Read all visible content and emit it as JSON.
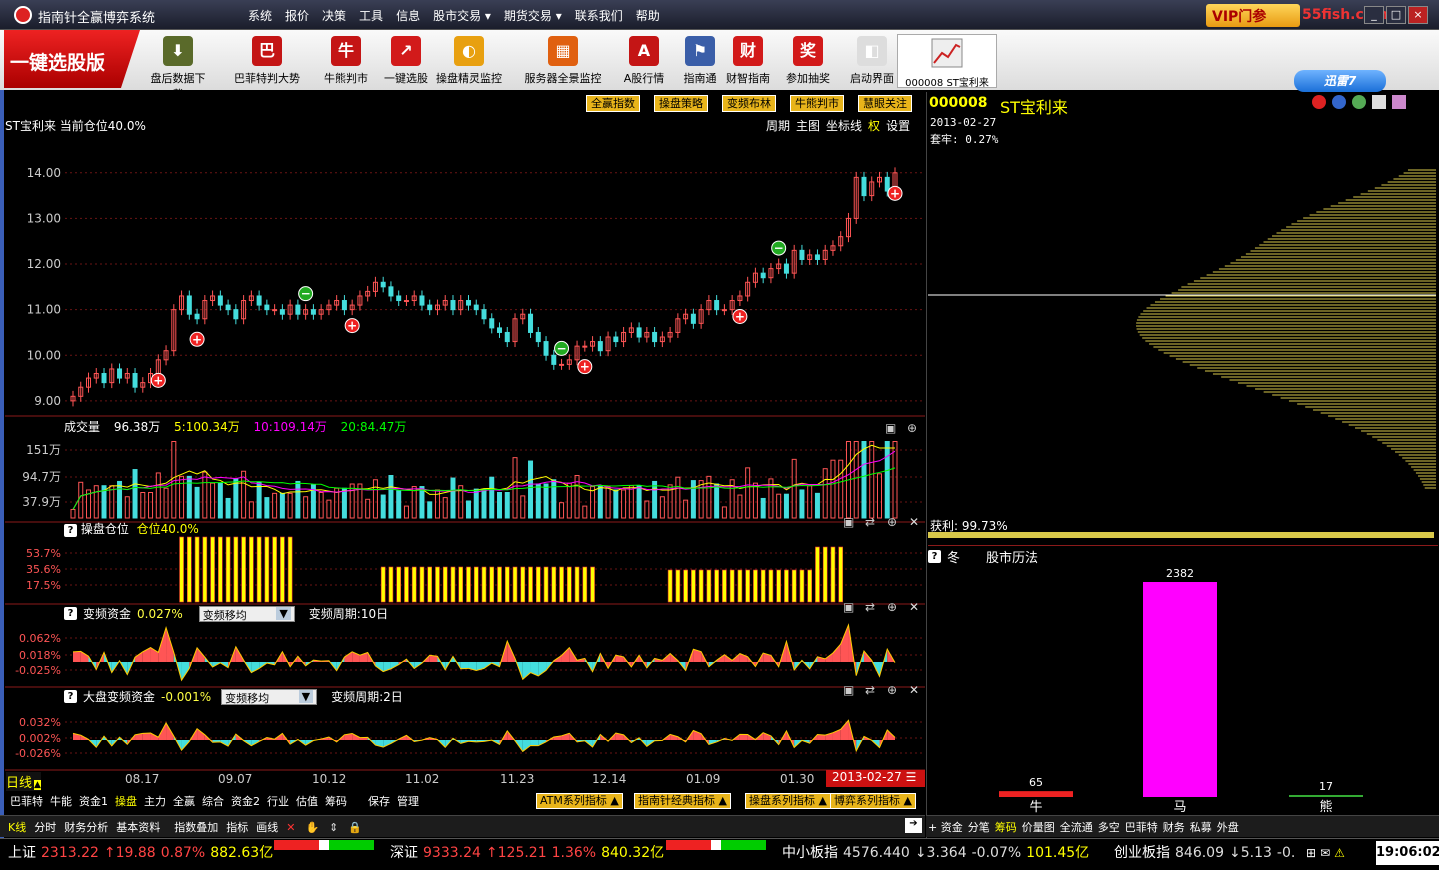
{
  "app": {
    "title": "指南针全赢博弈系统",
    "vip": "VIP门参",
    "site": "55fish.com"
  },
  "menu": [
    "系统",
    "报价",
    "决策",
    "工具",
    "信息",
    "股市交易",
    "期货交易",
    "联系我们",
    "帮助"
  ],
  "brand": "一键选股版",
  "toolbar": [
    {
      "label": "盘后数据下载",
      "icon": "download-icon",
      "color": "#5a6a2a"
    },
    {
      "label": "巴菲特判大势",
      "icon": "buffett-icon",
      "color": "#c41515"
    },
    {
      "label": "牛熊判市",
      "icon": "bull-bear-icon",
      "color": "#c41515"
    },
    {
      "label": "一键选股",
      "icon": "one-click-icon",
      "color": "#d21a1a"
    },
    {
      "label": "操盘精灵监控",
      "icon": "monitor-icon",
      "color": "#e8a010"
    },
    {
      "label": "服务器全景监控",
      "icon": "server-icon",
      "color": "#e06010"
    },
    {
      "label": "A股行情",
      "icon": "a-share-icon",
      "color": "#c41515"
    },
    {
      "label": "指南通",
      "icon": "guide-icon",
      "color": "#3a5ea8"
    },
    {
      "label": "财智指南",
      "icon": "finance-icon",
      "color": "#d21a1a"
    },
    {
      "label": "参加抽奖",
      "icon": "lottery-icon",
      "color": "#d21a1a"
    },
    {
      "label": "启动界面",
      "icon": "startup-icon",
      "color": "#dddddd"
    }
  ],
  "thumb": {
    "label": "000008 ST宝利来"
  },
  "xunlei": "迅雷7",
  "chart_buttons": [
    "全赢指数",
    "操盘策略",
    "变频布林",
    "牛熊判市",
    "慧眼关注"
  ],
  "main": {
    "header": "ST宝利来 当前仓位40.0%",
    "menu": [
      "周期",
      "主图",
      "坐标线",
      "权",
      "设置"
    ]
  },
  "volume": {
    "label": "成交量",
    "v": "96.38万",
    "ma5": "5:100.34万",
    "ma10": "10:109.14万",
    "ma20": "20:84.47万"
  },
  "pos": {
    "label": "操盘仓位",
    "value": "仓位40.0%",
    "ticks": [
      "53.7%",
      "35.6%",
      "17.5%"
    ]
  },
  "bp": {
    "label": "变频资金",
    "value": "0.027%",
    "select": "变频移均",
    "period": "变频周期:10日",
    "ticks": [
      "0.062%",
      "0.018%",
      "-0.025%"
    ]
  },
  "dp": {
    "label": "大盘变频资金",
    "value": "-0.001%",
    "select": "变频移均",
    "period": "变频周期:2日",
    "ticks": [
      "0.032%",
      "0.002%",
      "-0.026%"
    ]
  },
  "xaxis": {
    "period": "日线",
    "dates": [
      "08.17",
      "09.07",
      "10.12",
      "11.02",
      "11.23",
      "12.14",
      "01.09",
      "01.30"
    ],
    "current": "2013-02-27"
  },
  "bottabs": [
    "巴菲特",
    "牛能",
    "资金1",
    "操盘",
    "主力",
    "全赢",
    "综合",
    "资金2",
    "行业",
    "估值",
    "筹码",
    "保存",
    "管理"
  ],
  "indicator_buttons": [
    "ATM系列指标",
    "指南针经典指标",
    "操盘系列指标",
    "博弈系列指标"
  ],
  "bottom_row": [
    "K线",
    "分时",
    "财务分析",
    "基本资料",
    "指数叠加",
    "指标",
    "画线"
  ],
  "right": {
    "code": "000008",
    "name": "ST宝利来",
    "date": "2013-02-27",
    "trap": "套牢: 0.27%",
    "profit": "获利: 99.73%",
    "season": "冬",
    "history": "股市历法"
  },
  "right_tabs": [
    "资金",
    "分笔",
    "筹码",
    "价量图",
    "全流通",
    "多空",
    "巴菲特",
    "财务",
    "私募",
    "外盘"
  ],
  "status": [
    {
      "name": "上证",
      "price": "2313.22",
      "chg": "19.88",
      "pct": "0.87%",
      "amt": "882.63亿"
    },
    {
      "name": "深证",
      "price": "9333.24",
      "chg": "125.21",
      "pct": "1.36%",
      "amt": "840.32亿"
    },
    {
      "name": "中小板指",
      "price": "4576.440",
      "chg": "3.364",
      "pct": "-0.07%",
      "amt": "101.45亿"
    },
    {
      "name": "创业板指",
      "price": "846.09",
      "chg": "5.13",
      "pct": "-0."
    }
  ],
  "clock": "19:06:02",
  "chart_data": [
    {
      "type": "candlestick",
      "title": "ST宝利来",
      "y_ticks": [
        14.0,
        13.0,
        12.0,
        11.0,
        10.0,
        9.0
      ],
      "ylim": [
        8.8,
        14.5
      ],
      "close": [
        9.1,
        9.3,
        9.5,
        9.6,
        9.4,
        9.7,
        9.5,
        9.6,
        9.3,
        9.4,
        9.6,
        9.9,
        10.1,
        11.0,
        11.3,
        10.9,
        10.8,
        11.2,
        11.3,
        11.1,
        11.0,
        10.8,
        11.2,
        11.3,
        11.1,
        11.0,
        11.0,
        10.9,
        11.1,
        10.9,
        11.0,
        10.9,
        11.0,
        11.1,
        11.2,
        11.0,
        11.1,
        11.3,
        11.4,
        11.6,
        11.5,
        11.3,
        11.2,
        11.2,
        11.3,
        11.1,
        11.0,
        11.1,
        11.2,
        11.0,
        11.2,
        11.1,
        11.0,
        10.8,
        10.6,
        10.5,
        10.3,
        10.8,
        10.9,
        10.5,
        10.3,
        10.0,
        9.8,
        9.8,
        9.9,
        10.2,
        10.2,
        10.3,
        10.1,
        10.4,
        10.3,
        10.5,
        10.6,
        10.4,
        10.5,
        10.3,
        10.4,
        10.5,
        10.8,
        10.9,
        10.7,
        11.0,
        11.2,
        11.0,
        11.0,
        11.2,
        11.3,
        11.6,
        11.8,
        11.7,
        11.9,
        12.0,
        11.8,
        12.3,
        12.1,
        12.2,
        12.1,
        12.3,
        12.4,
        12.6,
        13.0,
        13.9,
        13.5,
        13.8,
        13.9,
        13.6,
        14.0
      ],
      "buy_signals": [
        11,
        16,
        36,
        66,
        86,
        106
      ],
      "sell_signals": [
        30,
        63,
        91
      ]
    },
    {
      "type": "bar",
      "title": "成交量",
      "y_ticks": [
        "151万",
        "94.7万",
        "37.9万"
      ]
    },
    {
      "type": "bar",
      "title": "操盘仓位",
      "segments": [
        {
          "from": 22,
          "to": 31,
          "value": 53.7
        },
        {
          "from": 42,
          "to": 65,
          "value": 35.6
        },
        {
          "from": 84,
          "to": 94,
          "value": 35.6
        },
        {
          "from": 97,
          "to": 100,
          "value": 53.7
        },
        {
          "from": 112,
          "to": 116,
          "value": 35.6
        }
      ]
    },
    {
      "type": "area",
      "title": "变频资金"
    },
    {
      "type": "area",
      "title": "大盘变频资金"
    },
    {
      "type": "bar",
      "title": "股市历法",
      "categories": [
        "牛",
        "马",
        "熊"
      ],
      "values": [
        65,
        2382,
        17
      ]
    }
  ]
}
